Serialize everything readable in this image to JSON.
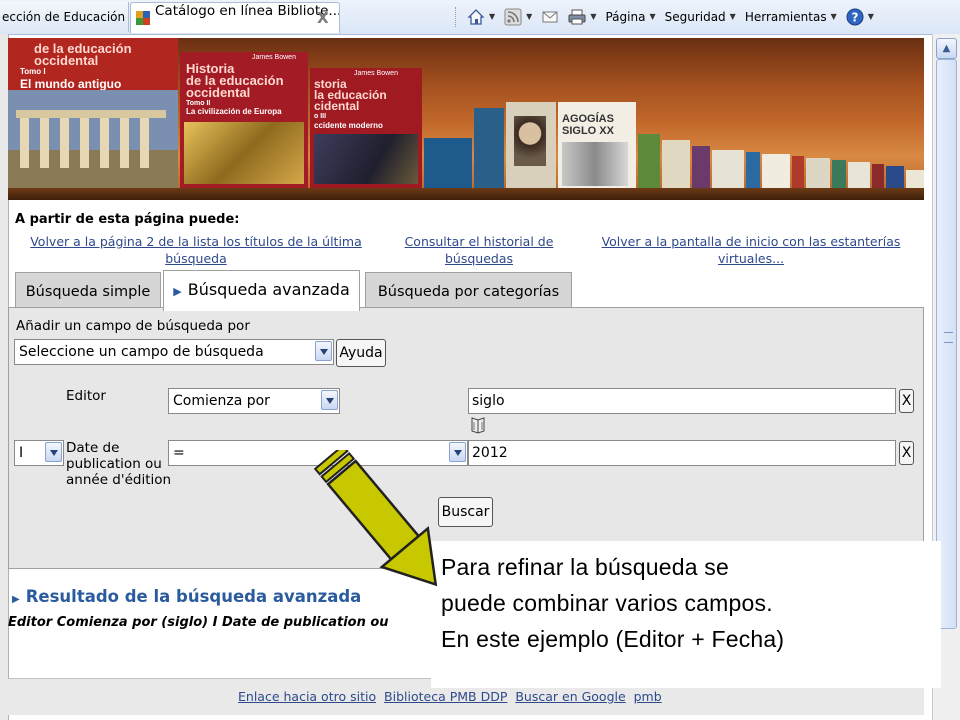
{
  "browser": {
    "tab1_label": "ección de Educación",
    "tab2_label": "Catálogo en línea Bibliote...",
    "tab2_close": "X",
    "toolbar": {
      "page_menu": "Página",
      "security_menu": "Seguridad",
      "tools_menu": "Herramientas"
    }
  },
  "banner": {
    "book1": {
      "title_line1": "de la educación",
      "title_line2": "occidental",
      "volume": "Tomo I",
      "subtitle": "El mundo antiguo"
    },
    "book2": {
      "author": "James Bowen",
      "title_line1": "Historia",
      "title_line2": "de la educación",
      "title_line3": "occidental",
      "volume": "Tomo II",
      "subtitle": "La civilización de Europa"
    },
    "book3": {
      "author": "James Bowen",
      "title_line1": "storia",
      "title_line2": "la educación",
      "title_line3": "cidental",
      "volume": "o III",
      "subtitle": "ccidente moderno"
    },
    "book4": {
      "title_line1": "AGOGÍAS",
      "title_line2": "SIGLO XX"
    }
  },
  "info": {
    "heading": "A partir de esta página puede:",
    "link1_line1": "Volver a la página 2 de la lista los títulos de la última",
    "link1_line2": "búsqueda",
    "link2_line1": "Consultar el historial de",
    "link2_line2": "búsquedas",
    "link3_line1": "Volver a la pantalla de inicio con las estanterías",
    "link3_line2": "virtuales..."
  },
  "tabs": {
    "simple": "Búsqueda simple",
    "advanced": "Búsqueda avanzada",
    "categories": "Búsqueda por categorías"
  },
  "form": {
    "add_field_label": "Añadir un campo de búsqueda por",
    "field_select_value": "Seleccione un campo de búsqueda",
    "help_button": "Ayuda",
    "row1": {
      "field_label": "Editor",
      "operator": "Comienza por",
      "value": "siglo",
      "remove": "X"
    },
    "row2": {
      "connector": "I",
      "field_label_line1": "Date de",
      "field_label_line2": "publication ou",
      "field_label_line3": "année d'édition",
      "operator": "=",
      "value": "2012",
      "remove": "X"
    },
    "search_button": "Buscar"
  },
  "results": {
    "heading": "Resultado de la búsqueda avanzada",
    "query": "Editor Comienza por (siglo) I Date de publication ou"
  },
  "footer": {
    "links": [
      "Enlace hacia otro sitio",
      "Biblioteca PMB DDP",
      "Buscar en Google",
      "pmb"
    ]
  },
  "callout": {
    "line1": "Para refinar la búsqueda se",
    "line2": "puede combinar varios campos.",
    "line3": "En este ejemplo (Editor + Fecha)"
  },
  "colors": {
    "link": "#2e4a8a",
    "results_heading": "#2a5b9e",
    "arrow_fill": "#c8c800"
  }
}
